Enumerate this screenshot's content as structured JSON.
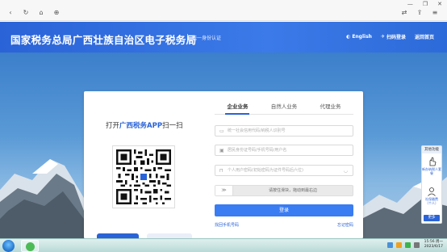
{
  "browser": {
    "back_icon": "chevron-left-icon",
    "refresh_icon": "refresh-icon",
    "home_icon": "home-icon",
    "globe_icon": "globe-icon"
  },
  "header": {
    "title": "国家税务总局广西壮族自治区电子税务局",
    "subtitle": "统一身份认证",
    "links": [
      "English",
      "扫码登录",
      "返回首页"
    ],
    "brand_color": "#2a63d7"
  },
  "qr_panel": {
    "title_prefix": "打开",
    "title_app": "广西税务APP",
    "title_suffix": "扫一扫"
  },
  "login": {
    "tabs": [
      "企业业务",
      "自然人业务",
      "代理业务"
    ],
    "active_tab": 0,
    "fields": {
      "company_placeholder": "统一社会信用代码/纳税人识别号",
      "id_placeholder": "居民身份证号码/手机号码/用户名",
      "password_placeholder": "个人用户密码(初始密码为证件号码后六位)"
    },
    "slider_text": "请按住滑块，拖动到最右边",
    "slider_handle": "≫",
    "submit": "登录",
    "link_left": "找回手机号码",
    "link_right": "忘记密码"
  },
  "sidebar": {
    "header": "其他功能",
    "item1": "新办纳税人套餐",
    "item2_line1": "社保缴费",
    "item2_line2": "（个人）",
    "more": "更多"
  },
  "taskbar": {
    "time": "15:56 周一",
    "date": "2023/6/17"
  }
}
